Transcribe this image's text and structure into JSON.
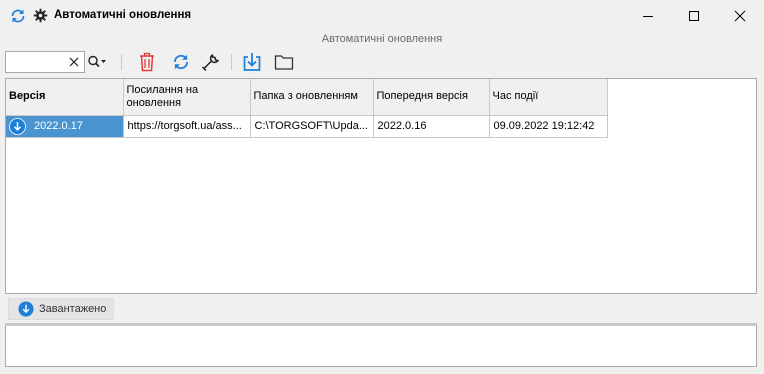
{
  "window": {
    "title": "Автоматичні оновлення",
    "subtitle": "Автоматичні оновлення"
  },
  "toolbar": {
    "search_value": "",
    "buttons": [
      "clear-icon",
      "search-options-icon",
      "delete-icon",
      "refresh-icon",
      "settings-wrench-icon",
      "download-icon",
      "folder-icon"
    ]
  },
  "grid": {
    "columns": [
      "Версія",
      "Посилання на оновлення",
      "Папка з оновленням",
      "Попередня версія",
      "Час події"
    ],
    "rows": [
      {
        "version": "2022.0.17",
        "link": "https://torgsoft.ua/ass...",
        "folder": "C:\\TORGSOFT\\Upda...",
        "previous": "2022.0.16",
        "time": "09.09.2022 19:12:42"
      }
    ]
  },
  "status": {
    "label": "Завантажено"
  },
  "colors": {
    "accent": "#1e7fd9",
    "selection": "#4a94d2",
    "delete": "#e53935"
  }
}
